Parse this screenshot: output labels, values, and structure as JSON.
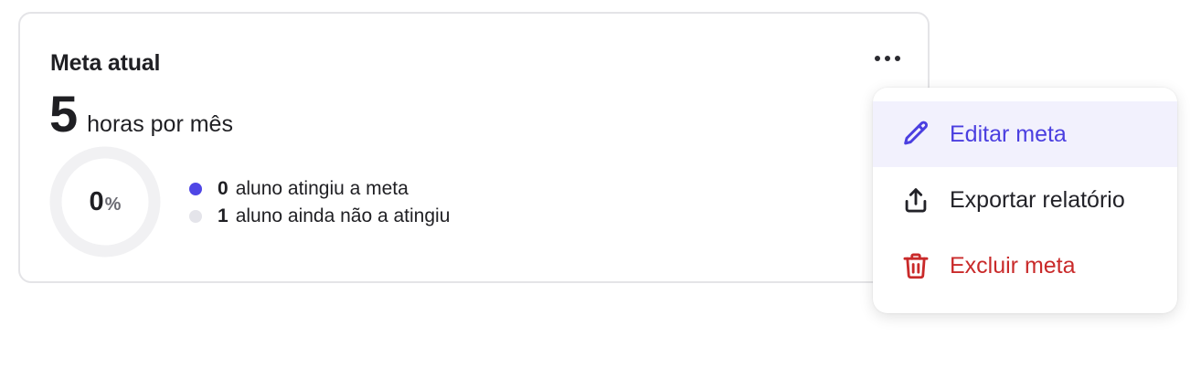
{
  "card": {
    "title": "Meta atual",
    "goal_value": "5",
    "goal_unit": "horas por mês",
    "progress": {
      "value": "0",
      "suffix": "%",
      "fraction": 0
    },
    "legend": [
      {
        "count": "0",
        "text": "aluno atingiu a meta",
        "color": "#4f46e5"
      },
      {
        "count": "1",
        "text": "aluno ainda não a atingiu",
        "color": "#e4e4ea"
      }
    ]
  },
  "menu": {
    "items": [
      {
        "label": "Editar meta",
        "icon": "pencil-icon",
        "color": "#4b3fe0",
        "active": true
      },
      {
        "label": "Exportar relatório",
        "icon": "export-icon",
        "color": "#222228",
        "active": false
      },
      {
        "label": "Excluir meta",
        "icon": "trash-icon",
        "color": "#c92a2a",
        "active": false
      }
    ]
  },
  "colors": {
    "ring_track": "#f1f1f3",
    "accent": "#4f46e5",
    "danger": "#c92a2a"
  }
}
